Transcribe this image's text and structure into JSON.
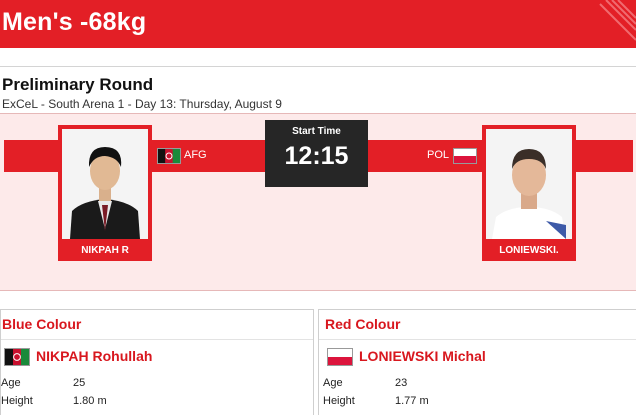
{
  "event": {
    "title": "Men's -68kg"
  },
  "round": {
    "title": "Preliminary Round",
    "subtitle": "ExCeL - South Arena 1 - Day 13: Thursday, August 9"
  },
  "match": {
    "start_label": "Start Time",
    "start_time": "12:15",
    "left": {
      "name": "NIKPAH R",
      "noc": "AFG"
    },
    "right": {
      "name": "LONIEWSKI.",
      "noc": "POL"
    }
  },
  "blue": {
    "heading": "Blue Colour",
    "name": "NIKPAH Rohullah",
    "age_label": "Age",
    "age": "25",
    "height_label": "Height",
    "height": "1.80 m"
  },
  "red": {
    "heading": "Red Colour",
    "name": "LONIEWSKI Michal",
    "age_label": "Age",
    "age": "23",
    "height_label": "Height",
    "height": "1.77 m"
  },
  "colors": {
    "accent": "#e31f26",
    "panel_bg": "#fdeaea",
    "time_bg": "#262626",
    "heading_red": "#d8171e"
  },
  "icons": [
    "afg-flag-icon",
    "pol-flag-icon"
  ]
}
